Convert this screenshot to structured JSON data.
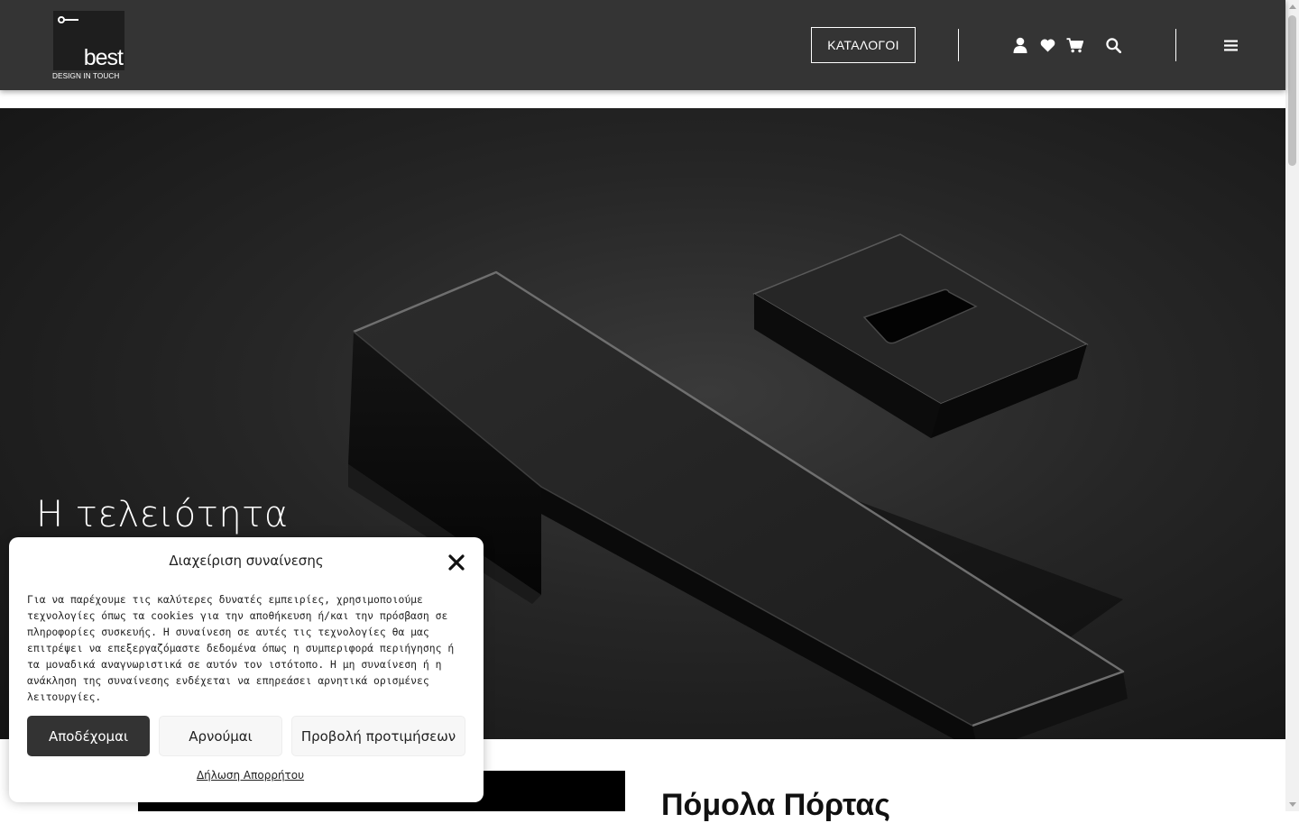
{
  "header": {
    "logo": {
      "word": "best",
      "tagline": "DESIGN IN TOUCH"
    },
    "catalog_label": "ΚΑΤΑΛΟΓΟΙ",
    "icons": [
      "user-icon",
      "heart-icon",
      "cart-icon",
      "search-icon",
      "menu-icon"
    ]
  },
  "hero": {
    "title": "Η τελειότητα"
  },
  "section": {
    "heading": "Πόμολα Πόρτας"
  },
  "cookie_banner": {
    "title": "Διαχείριση συναίνεσης",
    "body": "Για να παρέχουμε τις καλύτερες δυνατές εμπειρίες, χρησιμοποιούμε τεχνολογίες όπως τα cookies για την αποθήκευση ή/και την πρόσβαση σε πληροφορίες συσκευής. Η συναίνεση σε αυτές τις τεχνολογίες θα μας επιτρέψει να επεξεργαζόμαστε δεδομένα όπως η συμπεριφορά περιήγησης ή τα μοναδικά αναγνωριστικά σε αυτόν τον ιστότοπο. Η μη συναίνεση ή η ανάκληση της συναίνεσης ενδέχεται να επηρεάσει αρνητικά ορισμένες λειτουργίες.",
    "accept_label": "Αποδέχομαι",
    "deny_label": "Αρνούμαι",
    "preferences_label": "Προβολή προτιμήσεων",
    "privacy_link": "Δήλωση Απορρήτου"
  },
  "colors": {
    "header_bg": "#343434",
    "accent_dark": "#333333",
    "button_light": "#f7f7f7"
  }
}
